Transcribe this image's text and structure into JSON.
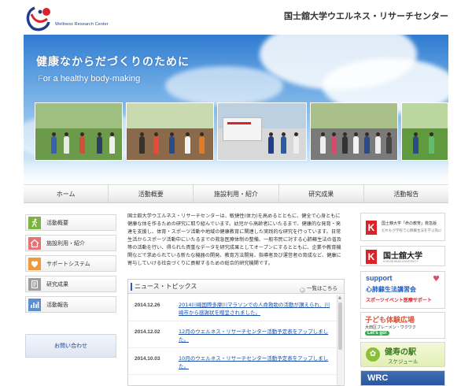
{
  "header": {
    "logo_text": "Wellness Research Center",
    "site_title": "国士舘大学ウエルネス・リサーチセンター"
  },
  "hero": {
    "title": "健康なからだづくりのために",
    "subtitle_lead": "F",
    "subtitle_rest": "or a healthy body-making"
  },
  "nav": {
    "items": [
      "ホーム",
      "活動概要",
      "施設利用・紹介",
      "研究成果",
      "活動報告"
    ]
  },
  "sidebar": {
    "items": [
      {
        "label": "活動概要",
        "icon": "run-icon",
        "color": "#7cb342"
      },
      {
        "label": "施設利用・紹介",
        "icon": "house-icon",
        "color": "#e57373"
      },
      {
        "label": "サポートシステム",
        "icon": "heart-icon",
        "color": "#f09a3e"
      },
      {
        "label": "研究成果",
        "icon": "document-icon",
        "color": "#9e9e9e"
      },
      {
        "label": "活動報告",
        "icon": "chart-icon",
        "color": "#5b8fd1"
      }
    ],
    "contact_label": "お問い合わせ"
  },
  "intro": {
    "text": "国士舘大学ウエルネス・リサーチセンターは、敏捷性(体力)を高めるとともに、健全で心身ともに健康な体を作るための研究に取り組んでいます。幼児から高齢者にいたるまで、健康的な発育・発達を支援し、体育・スポーツ活動や地域の健康教育に関連した実践的な研究を行っています。日常生活からスポーツ活動中にいたるまでの救急医療体制の整備、一般市民に対する心肺蘇生法の普及等の活動を行い、得られた貴重なデータを研究成果としてオープンにするとともに、企業や教育機関などで求められている新たな機器の開発、教育方法開発、指導者及び運営者の育成など、健康に寄与していける社会づくりに貢献するための総合的研究機関です。"
  },
  "news": {
    "title": "ニュース・トピックス",
    "more_label": "一覧はこちら",
    "items": [
      {
        "date": "2014.12.26",
        "text": "2014川崎国際多摩川マラソンでの人命救助の活動が讃えられ、川崎市から感謝状を贈呈されました。"
      },
      {
        "date": "2014.12.02",
        "text": "12月のウエルネス・リサーチセンター活動予定表をアップしました。"
      },
      {
        "date": "2014.10.03",
        "text": "10月のウエルネス・リサーチセンター活動予定表をアップしました。"
      }
    ]
  },
  "banners": {
    "b1_line1": "国士舘大学「命の教育」救急版",
    "b1_line2": "だれもが学校で心肺蘇生法を学ぶ為に",
    "b2_title": "国士舘大学",
    "b2_sub": "KOKUSHIKAN UNIVERSITY",
    "b3_line1": "support",
    "b3_line2": "心肺蘇生法講習会",
    "b3_line3": "スポーツイベント医療サポート",
    "b4_line1": "子ども体験広場",
    "b4_line2": "大田区ブレーメン・ワクワク",
    "b4_badge": "Let's go!",
    "b5_title": "健寿の駅",
    "b5_sub": "スケジュール",
    "b6_title": "WRC"
  }
}
